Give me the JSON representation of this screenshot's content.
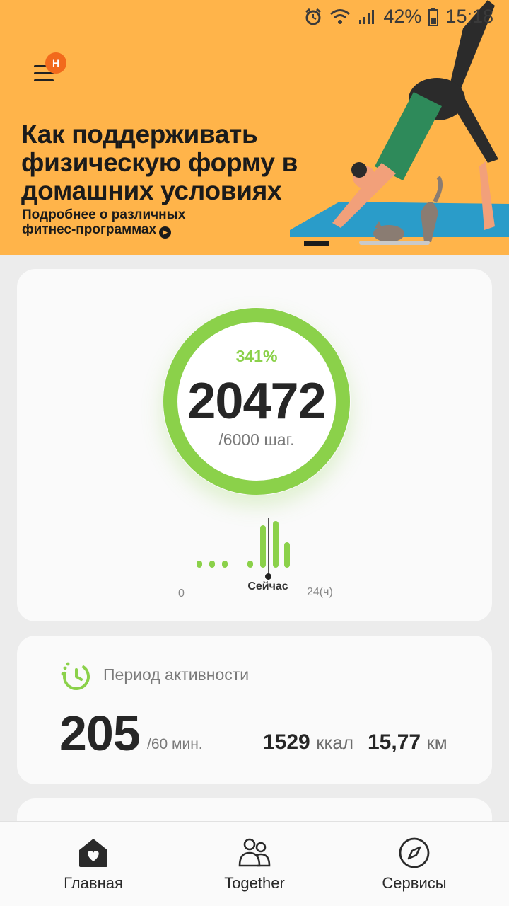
{
  "status_bar": {
    "battery_percent": "42%",
    "time": "15:18",
    "icons": [
      "alarm-icon",
      "wifi-icon",
      "signal-icon",
      "battery-icon"
    ]
  },
  "banner": {
    "menu_badge": "Н",
    "title": "Как поддерживать физическую форму в домашних условиях",
    "subtitle": "Подробнее о различных фитнес-программах",
    "background_color": "#ffb44a"
  },
  "steps": {
    "percent": "341%",
    "count": "20472",
    "goal": "/6000 шаг.",
    "progress_fraction": 1.0,
    "accent_color": "#8bd14a"
  },
  "histogram": {
    "start_label": "0",
    "now_label": "Сейчас",
    "end_label": "24(ч)",
    "bar_heights": [
      0.12,
      0.12,
      0.12,
      0.12,
      0.75,
      0.82,
      0.45
    ]
  },
  "activity": {
    "title": "Период активности",
    "minutes": "205",
    "goal": "/60 мин.",
    "kcal_value": "1529",
    "kcal_unit": "ккал",
    "distance_value": "15,77",
    "distance_unit": "км"
  },
  "bottom_nav": {
    "home_label": "Главная",
    "together_label": "Together",
    "services_label": "Сервисы"
  }
}
